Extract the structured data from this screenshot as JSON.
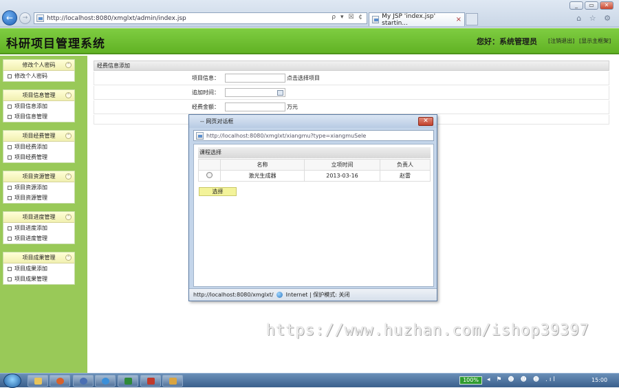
{
  "browser": {
    "window_buttons": [
      "▭",
      "✕"
    ],
    "address_url": "http://localhost:8080/xmglxt/admin/index.jsp",
    "address_tools": "ρ ▾ ☒ ¢",
    "tab_title": "My JSP 'index.jsp' startin...",
    "tab_close": "×",
    "toolbar_icons": "⌂ ☆ ⚙"
  },
  "header": {
    "title": "科研项目管理系统",
    "greeting": "您好：系统管理员",
    "logout": "[注销退出]",
    "home": "[显示主框架]"
  },
  "sidebar": {
    "groups": [
      {
        "title": "修改个人密码",
        "items": [
          "修改个人密码"
        ]
      },
      {
        "title": "项目信息管理",
        "items": [
          "项目信息添加",
          "项目信息管理"
        ]
      },
      {
        "title": "项目经费管理",
        "items": [
          "项目经费添加",
          "项目经费管理"
        ]
      },
      {
        "title": "项目资源管理",
        "items": [
          "项目资源添加",
          "项目资源管理"
        ]
      },
      {
        "title": "项目进度管理",
        "items": [
          "项目进度添加",
          "项目进度管理"
        ]
      },
      {
        "title": "项目成果管理",
        "items": [
          "项目成果添加",
          "项目成果管理"
        ]
      }
    ]
  },
  "form": {
    "title": "经费信息添加",
    "project_label": "项目信息：",
    "project_hint": "点击选择项目",
    "time_label": "追加时间：",
    "amount_label": "经费金额：",
    "amount_unit": "万元"
  },
  "dialog": {
    "title": "-- 网页对话框",
    "close": "✕",
    "url": "http://localhost:8080/xmglxt/xiangmu?type=xiangmuSele",
    "section_title": "课程选择",
    "columns": [
      "",
      "名称",
      "立项时间",
      "负责人"
    ],
    "rows": [
      {
        "name": "激光生成器",
        "date": "2013-03-16",
        "owner": "赵雷"
      }
    ],
    "select_button": "选择",
    "status_url": "http://localhost:8080/xmglxt/",
    "status_zone": "Internet | 保护模式: 关闭"
  },
  "watermark": "https://www.huzhan.com/ishop39397",
  "taskbar": {
    "battery": "100%",
    "tray": "◂ ⚑ ☻ ☻ ☻ .ıl",
    "clock": "15:00"
  }
}
